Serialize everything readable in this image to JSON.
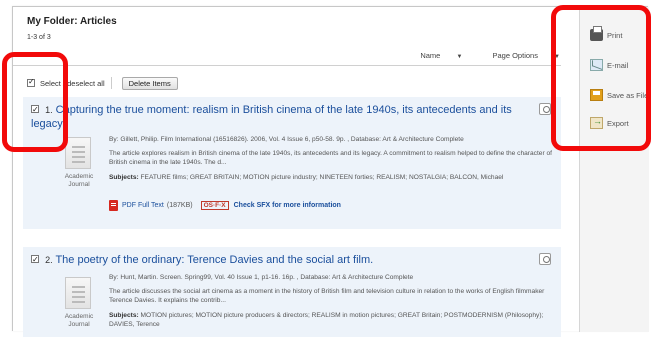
{
  "page": {
    "title": "My Folder: Articles",
    "count": "1-3 of 3"
  },
  "sort": {
    "name_label": "Name",
    "page_options_label": "Page Options"
  },
  "selection": {
    "select_all_label": "Select / deselect all",
    "delete_label": "Delete Items"
  },
  "results": [
    {
      "number": "1.",
      "title": "Capturing the true moment: realism in British cinema of the late 1940s, its antecedents and its legacy.",
      "byline": "By: Gillett, Philip. Film International (16516826). 2006, Vol. 4 Issue 6, p50-58. 9p. , Database: Art & Architecture Complete",
      "abstract": "The article explores realism in British cinema of the late 1940s, its antecedents and its legacy. A commitment to realism helped to define the character of British cinema in the late 1940s. The d...",
      "subjects_label": "Subjects:",
      "subjects": "FEATURE films; GREAT BRITAIN; MOTION picture industry; NINETEEN forties; REALISM; NOSTALGIA; BALCON, Michael",
      "doc_type": "Academic Journal",
      "pdf_label": "PDF Full Text",
      "pdf_size": "(187KB)",
      "sfx_badge": "OS·F·X",
      "sfx_link": "Check SFX for more information"
    },
    {
      "number": "2.",
      "title": "The poetry of the ordinary: Terence Davies and the social art film.",
      "byline": "By: Hunt, Martin. Screen. Spring99, Vol. 40 Issue 1, p1-16. 16p. , Database: Art & Architecture Complete",
      "abstract": "The article discusses the social art cinema as a moment in the history of British film and television culture in relation to the works of English filmmaker Terence Davies. It explains the contrib...",
      "subjects_label": "Subjects:",
      "subjects": "MOTION pictures; MOTION picture producers & directors; REALISM in motion pictures; GREAT Britain; POSTMODERNISM (Philosophy); DAVIES, Terence",
      "doc_type": "Academic Journal"
    }
  ],
  "sidebar": {
    "print": "Print",
    "email": "E-mail",
    "save": "Save as File",
    "export": "Export"
  },
  "colors": {
    "highlight": "#f20a0a",
    "link": "#1b4f9c",
    "result_bg": "#edf3fa"
  },
  "icons": [
    "printer-icon",
    "email-icon",
    "save-icon",
    "export-icon",
    "magnifier-icon",
    "document-icon",
    "pdf-icon"
  ]
}
